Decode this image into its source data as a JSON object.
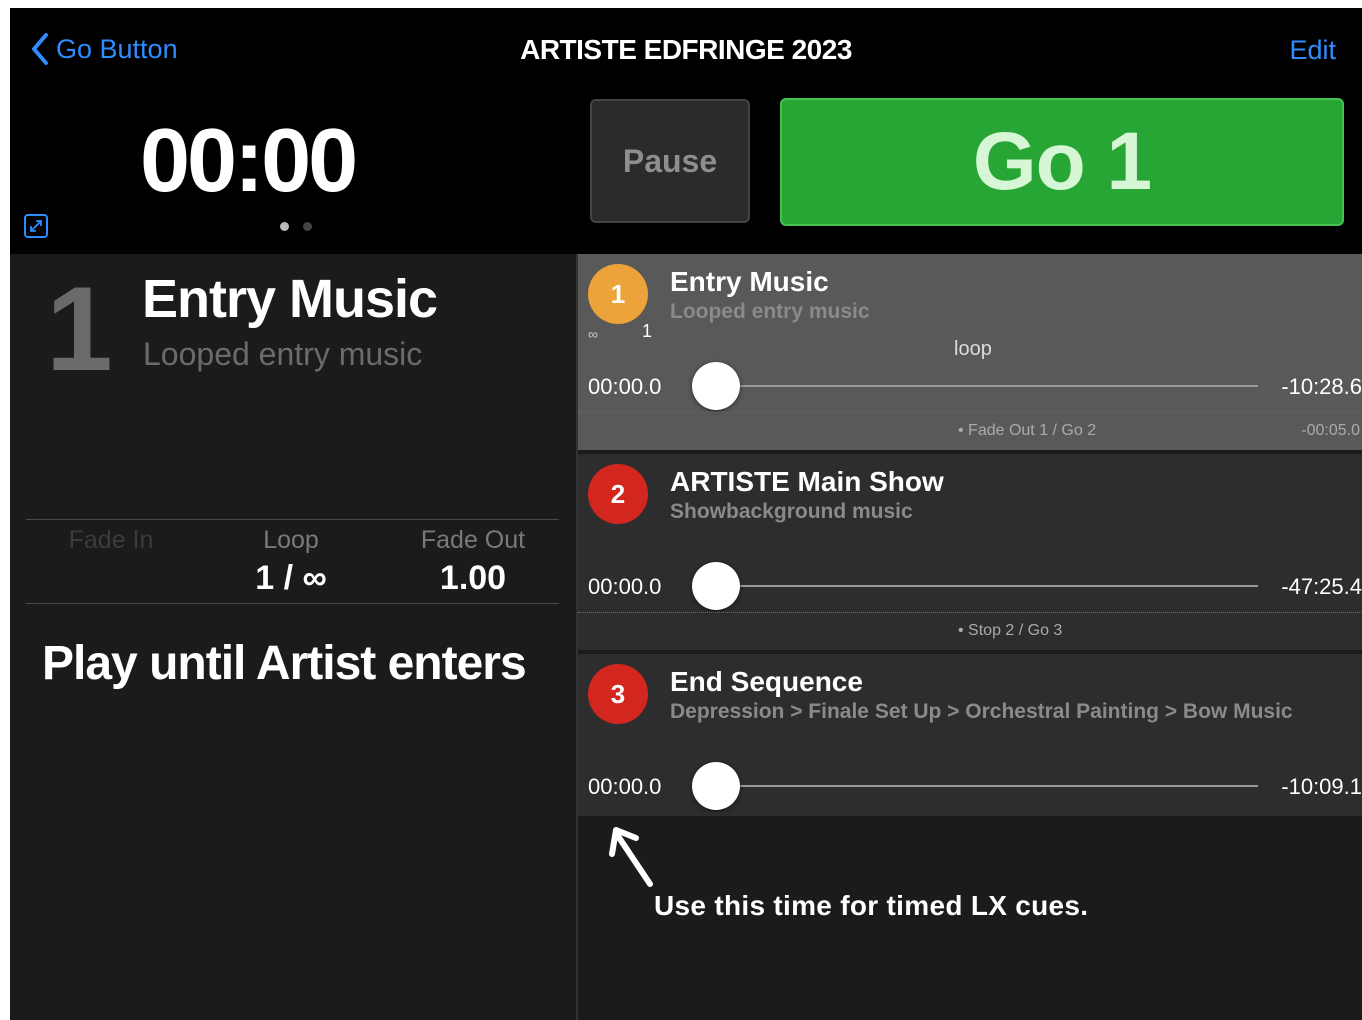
{
  "nav": {
    "back_label": "Go Button",
    "title": "ARTISTE EDFRINGE 2023",
    "edit_label": "Edit"
  },
  "header": {
    "clock": "00:00",
    "pause_label": "Pause",
    "go_label": "Go 1",
    "page_dots": 2,
    "active_dot": 0
  },
  "current": {
    "number": "1",
    "title": "Entry Music",
    "subtitle": "Looped entry music",
    "params": [
      {
        "label": "Fade In",
        "value": ""
      },
      {
        "label": "Loop",
        "value": "1 / ∞"
      },
      {
        "label": "Fade Out",
        "value": "1.00"
      }
    ],
    "notes": "Play until Artist enters"
  },
  "cues": [
    {
      "number": "1",
      "name": "Entry Music",
      "desc": "Looped entry music",
      "color": "#eba33a",
      "selected": true,
      "loop_icon": "∞",
      "loop_count": "1",
      "loop_label": "loop",
      "start": "00:00.0",
      "remaining": "-10:28.6",
      "progress": 0,
      "next_action": "• Fade Out 1 / Go 2",
      "next_time": "-00:05.0"
    },
    {
      "number": "2",
      "name": "ARTISTE Main Show",
      "desc": "Showbackground music",
      "color": "#d3261f",
      "selected": false,
      "start": "00:00.0",
      "remaining": "-47:25.4",
      "progress": 0,
      "next_action": "• Stop 2 / Go 3",
      "next_time": ""
    },
    {
      "number": "3",
      "name": "End Sequence",
      "desc": "Depression > Finale Set Up > Orchestral Painting > Bow Music",
      "color": "#d3261f",
      "selected": false,
      "start": "00:00.0",
      "remaining": "-10:09.1",
      "progress": 0
    }
  ],
  "annotation": "Use this time for timed LX cues."
}
